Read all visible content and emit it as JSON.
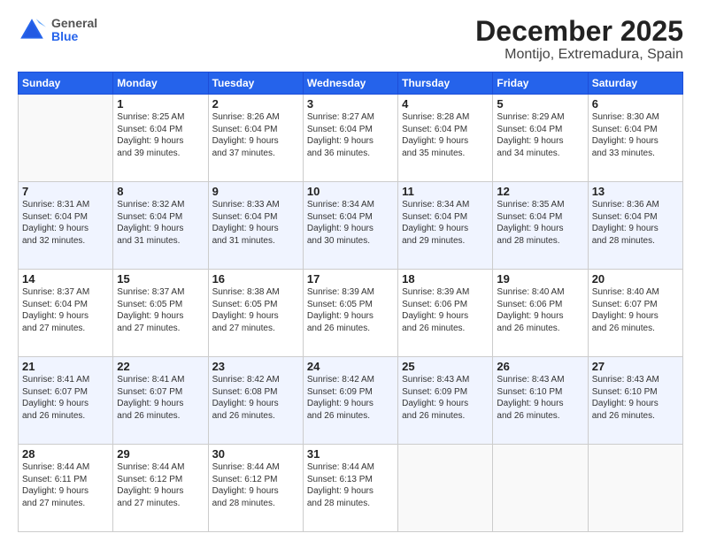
{
  "header": {
    "logo_general": "General",
    "logo_blue": "Blue",
    "title": "December 2025",
    "subtitle": "Montijo, Extremadura, Spain"
  },
  "days_of_week": [
    "Sunday",
    "Monday",
    "Tuesday",
    "Wednesday",
    "Thursday",
    "Friday",
    "Saturday"
  ],
  "weeks": [
    [
      {
        "day": "",
        "info": ""
      },
      {
        "day": "1",
        "info": "Sunrise: 8:25 AM\nSunset: 6:04 PM\nDaylight: 9 hours\nand 39 minutes."
      },
      {
        "day": "2",
        "info": "Sunrise: 8:26 AM\nSunset: 6:04 PM\nDaylight: 9 hours\nand 37 minutes."
      },
      {
        "day": "3",
        "info": "Sunrise: 8:27 AM\nSunset: 6:04 PM\nDaylight: 9 hours\nand 36 minutes."
      },
      {
        "day": "4",
        "info": "Sunrise: 8:28 AM\nSunset: 6:04 PM\nDaylight: 9 hours\nand 35 minutes."
      },
      {
        "day": "5",
        "info": "Sunrise: 8:29 AM\nSunset: 6:04 PM\nDaylight: 9 hours\nand 34 minutes."
      },
      {
        "day": "6",
        "info": "Sunrise: 8:30 AM\nSunset: 6:04 PM\nDaylight: 9 hours\nand 33 minutes."
      }
    ],
    [
      {
        "day": "7",
        "info": "Sunrise: 8:31 AM\nSunset: 6:04 PM\nDaylight: 9 hours\nand 32 minutes."
      },
      {
        "day": "8",
        "info": "Sunrise: 8:32 AM\nSunset: 6:04 PM\nDaylight: 9 hours\nand 31 minutes."
      },
      {
        "day": "9",
        "info": "Sunrise: 8:33 AM\nSunset: 6:04 PM\nDaylight: 9 hours\nand 31 minutes."
      },
      {
        "day": "10",
        "info": "Sunrise: 8:34 AM\nSunset: 6:04 PM\nDaylight: 9 hours\nand 30 minutes."
      },
      {
        "day": "11",
        "info": "Sunrise: 8:34 AM\nSunset: 6:04 PM\nDaylight: 9 hours\nand 29 minutes."
      },
      {
        "day": "12",
        "info": "Sunrise: 8:35 AM\nSunset: 6:04 PM\nDaylight: 9 hours\nand 28 minutes."
      },
      {
        "day": "13",
        "info": "Sunrise: 8:36 AM\nSunset: 6:04 PM\nDaylight: 9 hours\nand 28 minutes."
      }
    ],
    [
      {
        "day": "14",
        "info": "Sunrise: 8:37 AM\nSunset: 6:04 PM\nDaylight: 9 hours\nand 27 minutes."
      },
      {
        "day": "15",
        "info": "Sunrise: 8:37 AM\nSunset: 6:05 PM\nDaylight: 9 hours\nand 27 minutes."
      },
      {
        "day": "16",
        "info": "Sunrise: 8:38 AM\nSunset: 6:05 PM\nDaylight: 9 hours\nand 27 minutes."
      },
      {
        "day": "17",
        "info": "Sunrise: 8:39 AM\nSunset: 6:05 PM\nDaylight: 9 hours\nand 26 minutes."
      },
      {
        "day": "18",
        "info": "Sunrise: 8:39 AM\nSunset: 6:06 PM\nDaylight: 9 hours\nand 26 minutes."
      },
      {
        "day": "19",
        "info": "Sunrise: 8:40 AM\nSunset: 6:06 PM\nDaylight: 9 hours\nand 26 minutes."
      },
      {
        "day": "20",
        "info": "Sunrise: 8:40 AM\nSunset: 6:07 PM\nDaylight: 9 hours\nand 26 minutes."
      }
    ],
    [
      {
        "day": "21",
        "info": "Sunrise: 8:41 AM\nSunset: 6:07 PM\nDaylight: 9 hours\nand 26 minutes."
      },
      {
        "day": "22",
        "info": "Sunrise: 8:41 AM\nSunset: 6:07 PM\nDaylight: 9 hours\nand 26 minutes."
      },
      {
        "day": "23",
        "info": "Sunrise: 8:42 AM\nSunset: 6:08 PM\nDaylight: 9 hours\nand 26 minutes."
      },
      {
        "day": "24",
        "info": "Sunrise: 8:42 AM\nSunset: 6:09 PM\nDaylight: 9 hours\nand 26 minutes."
      },
      {
        "day": "25",
        "info": "Sunrise: 8:43 AM\nSunset: 6:09 PM\nDaylight: 9 hours\nand 26 minutes."
      },
      {
        "day": "26",
        "info": "Sunrise: 8:43 AM\nSunset: 6:10 PM\nDaylight: 9 hours\nand 26 minutes."
      },
      {
        "day": "27",
        "info": "Sunrise: 8:43 AM\nSunset: 6:10 PM\nDaylight: 9 hours\nand 26 minutes."
      }
    ],
    [
      {
        "day": "28",
        "info": "Sunrise: 8:44 AM\nSunset: 6:11 PM\nDaylight: 9 hours\nand 27 minutes."
      },
      {
        "day": "29",
        "info": "Sunrise: 8:44 AM\nSunset: 6:12 PM\nDaylight: 9 hours\nand 27 minutes."
      },
      {
        "day": "30",
        "info": "Sunrise: 8:44 AM\nSunset: 6:12 PM\nDaylight: 9 hours\nand 28 minutes."
      },
      {
        "day": "31",
        "info": "Sunrise: 8:44 AM\nSunset: 6:13 PM\nDaylight: 9 hours\nand 28 minutes."
      },
      {
        "day": "",
        "info": ""
      },
      {
        "day": "",
        "info": ""
      },
      {
        "day": "",
        "info": ""
      }
    ]
  ]
}
